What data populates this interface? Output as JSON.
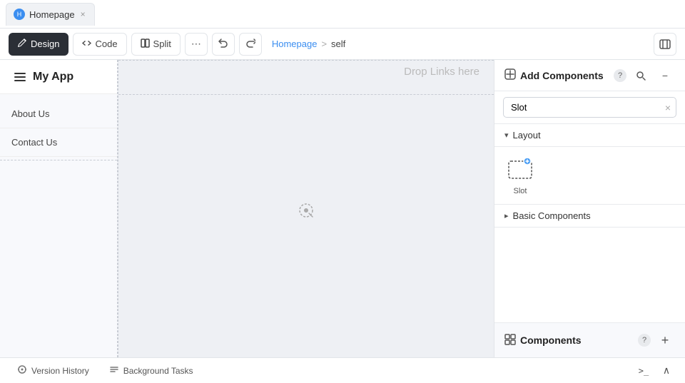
{
  "tab": {
    "title": "Homepage",
    "close_label": "×"
  },
  "toolbar": {
    "design_label": "Design",
    "code_label": "Code",
    "split_label": "Split",
    "more_label": "⋯",
    "undo_label": "↺",
    "redo_label": "↻",
    "breadcrumb_home": "Homepage",
    "breadcrumb_sep": ">",
    "breadcrumb_current": "self"
  },
  "app_preview": {
    "title": "My App",
    "drop_links_label": "Drop Links here"
  },
  "nav_items": [
    {
      "label": "About Us"
    },
    {
      "label": "Contact Us"
    }
  ],
  "right_panel": {
    "title": "Add Components",
    "help": "?",
    "search_placeholder": "Slot",
    "search_value": "Slot",
    "layout_section": "Layout",
    "slot_component_label": "Slot",
    "basic_components_section": "Basic Components"
  },
  "bottom_panel": {
    "title": "Components",
    "help": "?"
  },
  "bottom_bar": {
    "version_history_label": "Version History",
    "background_tasks_label": "Background Tasks"
  },
  "icons": {
    "tab_icon": "H",
    "design_icon": "✈",
    "code_icon": "</>",
    "split_icon": "⊞",
    "panel_icon": "⊟",
    "add_components_icon": "🔧",
    "search_icon": "🔍",
    "minimize_icon": "−",
    "layout_chevron": "▾",
    "basic_chevron": "▸",
    "slot_icon": "⊹",
    "components_icon": "≡",
    "components_add": "+",
    "version_history_icon": "⊙",
    "background_tasks_icon": "≡",
    "terminal_icon": ">_",
    "collapse_icon": "∧"
  }
}
